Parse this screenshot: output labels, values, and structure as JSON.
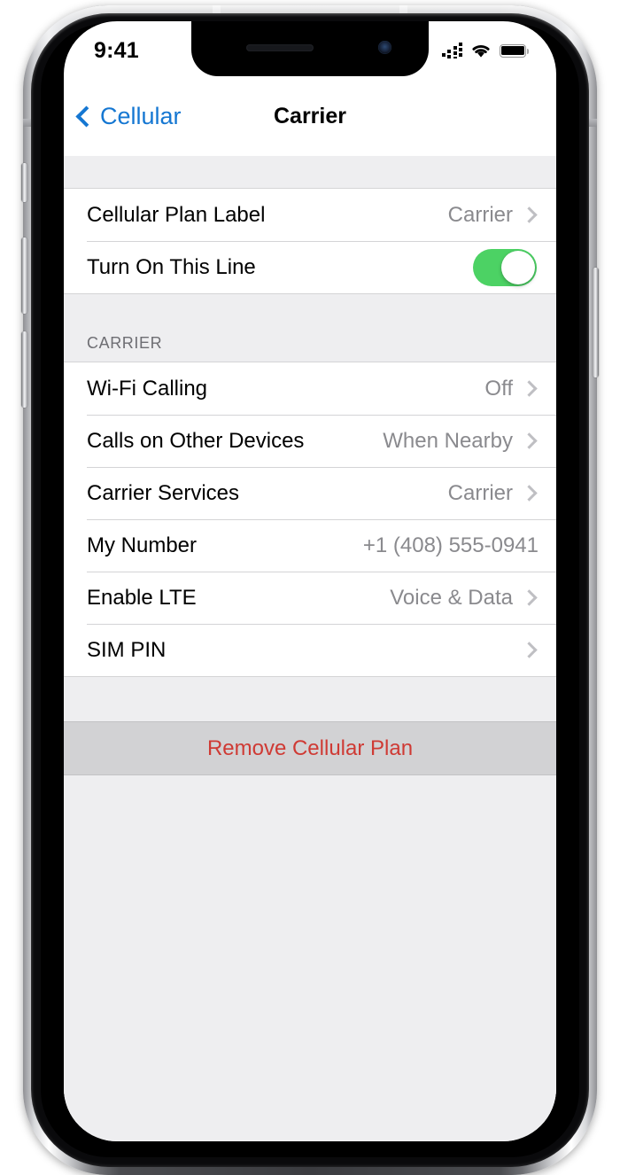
{
  "status_bar": {
    "time": "9:41",
    "signal_icon": "cellular-signal-dots-icon",
    "wifi_icon": "wifi-icon",
    "battery_icon": "battery-full-icon"
  },
  "nav_bar": {
    "back_label": "Cellular",
    "back_icon": "chevron-left-icon",
    "title": "Carrier"
  },
  "colors": {
    "accent_blue": "#1577d2",
    "toggle_green": "#4cd264",
    "destructive_red": "#cf3a34",
    "group_background": "#eeeef0",
    "row_background": "#ffffff",
    "pressed_row": "#d2d2d4",
    "separator": "#d4d4d6",
    "secondary_text": "#8a8a8e"
  },
  "sections": [
    {
      "header": "",
      "rows": [
        {
          "label": "Cellular Plan Label",
          "value": "Carrier",
          "accessory": "disclosure"
        },
        {
          "label": "Turn On This Line",
          "value": "",
          "accessory": "toggle",
          "toggle_on": true
        }
      ]
    },
    {
      "header": "CARRIER",
      "rows": [
        {
          "label": "Wi-Fi Calling",
          "value": "Off",
          "accessory": "disclosure"
        },
        {
          "label": "Calls on Other Devices",
          "value": "When Nearby",
          "accessory": "disclosure"
        },
        {
          "label": "Carrier Services",
          "value": "Carrier",
          "accessory": "disclosure"
        },
        {
          "label": "My Number",
          "value": "+1 (408) 555-0941",
          "accessory": "none"
        },
        {
          "label": "Enable LTE",
          "value": "Voice & Data",
          "accessory": "disclosure"
        },
        {
          "label": "SIM PIN",
          "value": "",
          "accessory": "disclosure"
        }
      ]
    }
  ],
  "destructive_action": {
    "label": "Remove Cellular Plan"
  },
  "hardware": {
    "mute_switch": "mute-switch",
    "volume_up": "volume-up-button",
    "volume_down": "volume-down-button",
    "side_button": "side-power-button",
    "speaker": "earpiece-speaker",
    "camera": "front-camera"
  }
}
